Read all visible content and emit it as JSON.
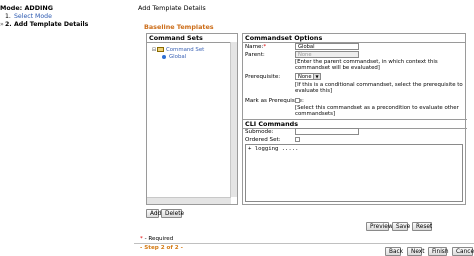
{
  "wizard": {
    "mode_text": "Mode: ADDING",
    "steps": [
      {
        "arrow": "",
        "num": "1.",
        "label": "Select Mode"
      },
      {
        "arrow": "»",
        "num": "2.",
        "label": "Add Template Details"
      }
    ]
  },
  "page": {
    "title": "Add Template Details",
    "section_title": "Baseline Templates"
  },
  "command_sets": {
    "header": "Command Sets",
    "tree": [
      {
        "label": "Command Set",
        "icon": "folder-icon",
        "toggle": "⊟"
      },
      {
        "label": "Global",
        "icon": "radio-selected-icon"
      }
    ],
    "add_label": "Add",
    "delete_label": "Delete"
  },
  "options": {
    "header": "Commandset Options",
    "name_label": "Name:",
    "name_required": "*",
    "name_value": "Global",
    "parent_label": "Parent:",
    "parent_value": "None",
    "parent_hint": "[Enter the parent commandset, in which context this commandset will be evaluated]",
    "prereq_label": "Prerequisite:",
    "prereq_value": "None",
    "prereq_hint": "[If this is a conditional commandset, select the prerequisite to evaluate this]",
    "markprereq_label": "Mark as Prerequisite:",
    "markprereq_hint": "[Select this commandset as a precondition to evaluate other commandsets]",
    "cli_header": "CLI Commands",
    "submode_label": "Submode:",
    "ordered_label": "Ordered Set:",
    "cli_text": "+ logging ....."
  },
  "actions": {
    "preview": "Preview",
    "save": "Save",
    "reset": "Reset",
    "back": "Back",
    "next": "Next",
    "finish": "Finish",
    "cancel": "Cancel"
  },
  "footer": {
    "required_star": "*",
    "required_text": " - Required",
    "step_text": "- Step 2 of 2 -"
  }
}
